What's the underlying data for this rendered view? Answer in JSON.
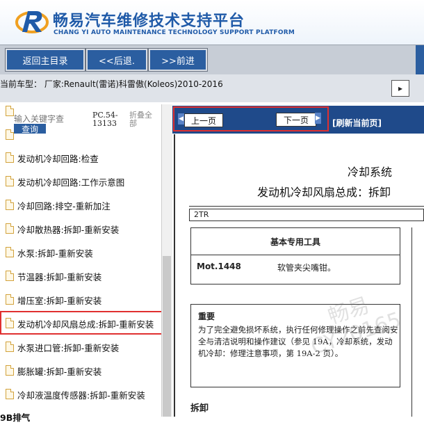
{
  "header": {
    "title": "畅易汽车维修技术支持平台",
    "subtitle": "CHANG YI AUTO MAINTENANCE TECHNOLOGY SUPPORT PLATFORM"
  },
  "nav": {
    "home": "返回主目录",
    "back": "<<后退.",
    "forward": ">>前进"
  },
  "model_bar": {
    "text": "当前车型： 厂家:Renault(雷诺)科雷傲(Koleos)2010-2016"
  },
  "left_panel": {
    "search_placeholder": "输入关键字查",
    "search_button": "查询",
    "pc_code": "PC.54-13133",
    "collapse_all": "折叠全部",
    "items": [
      {
        "label": "发动机冷却回路:检查"
      },
      {
        "label": "发动机冷却回路:工作示意图"
      },
      {
        "label": "冷却回路:排空-重新加注"
      },
      {
        "label": "冷却散热器:拆卸-重新安装"
      },
      {
        "label": "水泵:拆卸-重新安装"
      },
      {
        "label": "节温器:拆卸-重新安装"
      },
      {
        "label": "增压室:拆卸-重新安装"
      },
      {
        "label": "发动机冷却风扇总成:拆卸-重新安装"
      },
      {
        "label": "水泵进口管:拆卸-重新安装"
      },
      {
        "label": "膨胀罐:拆卸-重新安装"
      },
      {
        "label": "冷却液温度传感器:拆卸-重新安装"
      }
    ],
    "partial_bottom": "9B排气"
  },
  "pager": {
    "prev": "上一页",
    "next": "下一页",
    "refresh": "[刷新当前页]"
  },
  "document": {
    "title1": "冷却系统",
    "title2": "发动机冷却风扇总成：拆卸",
    "engine_code": "2TR",
    "tools_heading": "基本专用工具",
    "tool_code": "Mot.1448",
    "tool_desc": "软管夹尖嘴钳。",
    "notice_title": "重要",
    "notice_body": "为了完全避免损坏系统，执行任何修理操作之前先查阅安全与清洁说明和操作建议（参见 19A，冷却系统，发动机冷却：修理注意事项，第 19A-2 页）。",
    "section": "拆卸",
    "watermark1": "畅易",
    "watermark2": "CY20165"
  },
  "colors": {
    "brand_blue": "#1f5aa8",
    "nav_blue": "#2b5ea0",
    "highlight_red": "#e03030"
  }
}
